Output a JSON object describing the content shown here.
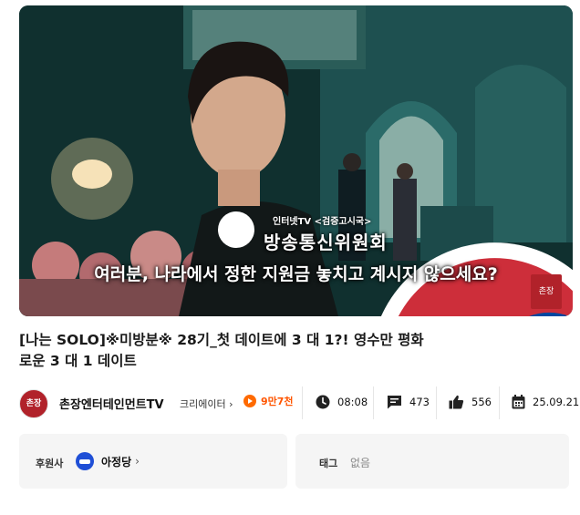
{
  "video": {
    "subtitle": "여러분, 나라에서 정한 지원금 놓치고 계시지 않으세요?",
    "overlay_caption_top": "인터넷TV <검증고시국>",
    "overlay_org": "방송통신위원회",
    "stamp_text": "촌장"
  },
  "title": {
    "line1": "[나는 SOLO]※미방분※ 28기_첫 데이트에 3 대 1?! 영수만 평화",
    "line2": "로운 3 대 1 데이트"
  },
  "meta": {
    "avatar_text": "촌장",
    "channel_name": "촌장엔터테인먼트TV",
    "creator_label": "크리에이터 ›",
    "views": "9만7천",
    "duration": "08:08",
    "comments": "473",
    "likes": "556",
    "date": "25.09.21"
  },
  "sponsor": {
    "label": "후원사",
    "name": "아정당",
    "chevron": "›"
  },
  "tags": {
    "label": "태그",
    "value": "없음"
  }
}
